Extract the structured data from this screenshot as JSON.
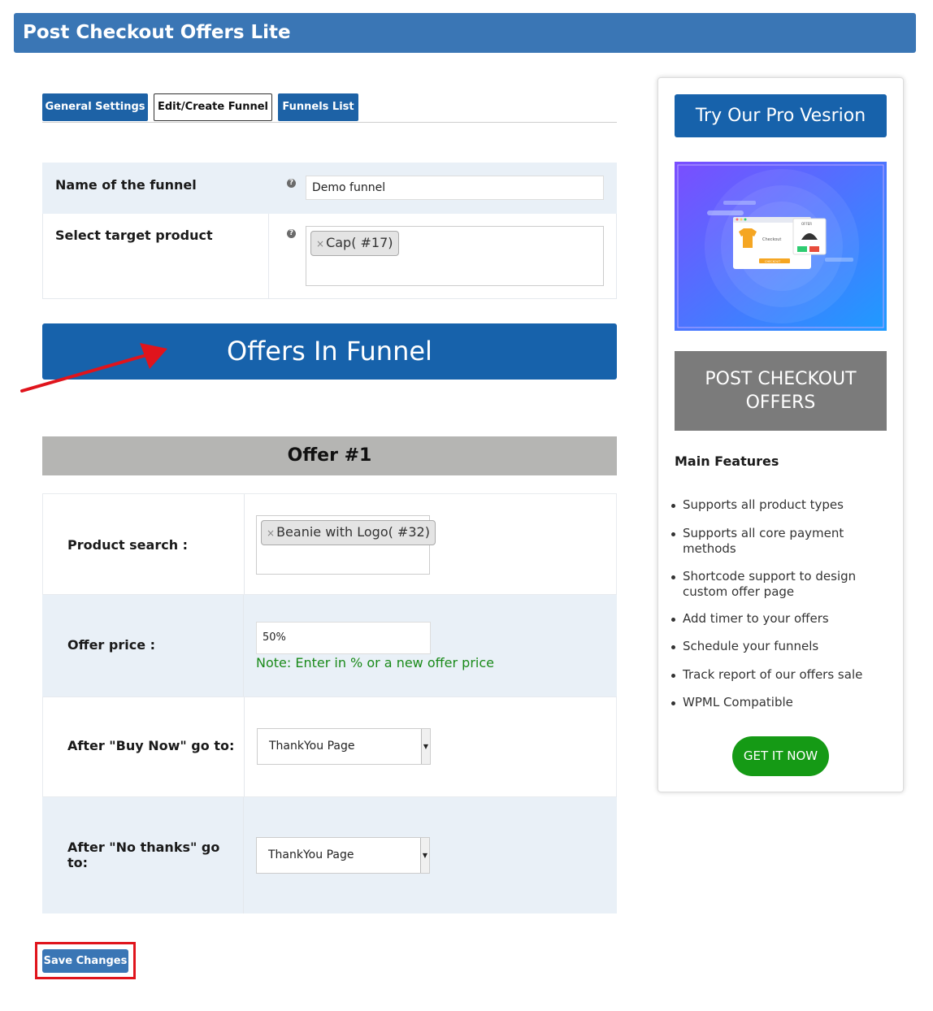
{
  "app": {
    "title": "Post Checkout Offers Lite"
  },
  "tabs": [
    {
      "label": "General Settings",
      "active": false
    },
    {
      "label": "Edit/Create Funnel",
      "active": true
    },
    {
      "label": "Funnels List",
      "active": false
    }
  ],
  "funnel": {
    "name_label": "Name of the funnel",
    "name_value": "Demo funnel",
    "target_label": "Select target product",
    "target_chip": "Cap( #17)",
    "help_glyph": "?"
  },
  "offers_heading": "Offers In Funnel",
  "offer": {
    "heading": "Offer #1",
    "product_label": "Product search :",
    "product_chip": "Beanie with Logo( #32)",
    "price_label": "Offer price :",
    "price_value": "50%",
    "price_note": "Note: Enter in % or a new offer price",
    "buy_now_label": "After \"Buy Now\" go to:",
    "buy_now_value": "ThankYou Page",
    "no_thanks_label": "After \"No thanks\" go to:",
    "no_thanks_value": "ThankYou Page"
  },
  "chip_remove_glyph": "×",
  "save_label": "Save Changes",
  "sidebar": {
    "pro_button": "Try Our Pro Vesrion",
    "promo_text": {
      "checkout": "Checkout",
      "offer": "OFFER",
      "checkout_button": "CHECKOUT"
    },
    "grey_box": "POST CHECKOUT OFFERS",
    "features_title": "Main Features",
    "features": [
      "Supports all product types",
      "Supports all core payment methods",
      "Shortcode support to design custom offer page",
      "Add timer to your offers",
      "Schedule your funnels",
      "Track report of our offers sale",
      "WPML Compatible"
    ],
    "get_button": "GET IT NOW"
  },
  "colors": {
    "header_blue": "#3a76b5",
    "primary_blue": "#1762ab",
    "row_blue": "#e9f0f7",
    "note_green": "#1a8a1a",
    "cta_green": "#159a15",
    "annotation_red": "#e0141c"
  }
}
